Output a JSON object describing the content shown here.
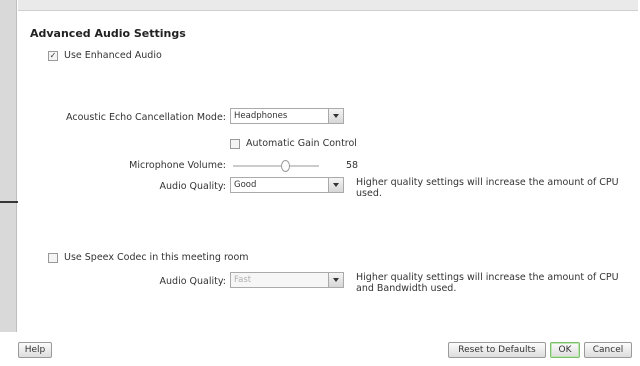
{
  "section": {
    "title": "Advanced Audio Settings"
  },
  "enhanced_audio": {
    "label": "Use Enhanced Audio",
    "checked": true
  },
  "echo_cancellation": {
    "label": "Acoustic Echo Cancellation Mode:",
    "value": "Headphones"
  },
  "agc": {
    "label": "Automatic Gain Control",
    "checked": false
  },
  "mic_volume": {
    "label": "Microphone Volume:",
    "value": "58",
    "level_percent": 58
  },
  "audio_quality_1": {
    "label": "Audio Quality:",
    "value": "Good",
    "hint": "Higher quality settings will increase the amount of CPU used."
  },
  "speex": {
    "label": "Use Speex Codec in this meeting room",
    "checked": false
  },
  "audio_quality_2": {
    "label": "Audio Quality:",
    "value": "Fast",
    "hint": "Higher quality settings will increase the amount of CPU and Bandwidth used."
  },
  "footer": {
    "help_label": "Help",
    "reset_label": "Reset to Defaults",
    "ok_label": "OK",
    "cancel_label": "Cancel"
  },
  "colors": {
    "ok_border": "#7cbf6a",
    "panel_bg": "#d9d9d9"
  }
}
